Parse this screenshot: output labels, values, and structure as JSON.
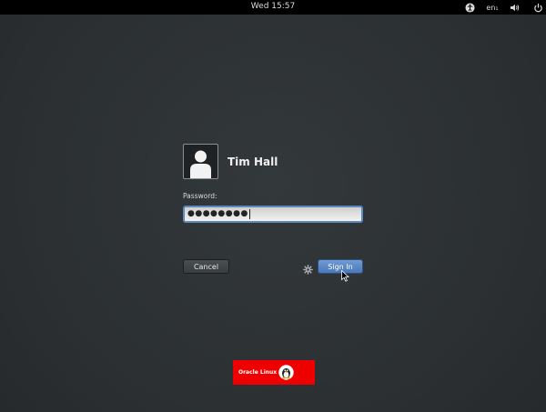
{
  "topbar": {
    "clock": "Wed 15:57",
    "language": "en₁",
    "icons": [
      "accessibility-icon",
      "volume-icon",
      "power-icon"
    ]
  },
  "login": {
    "username": "Tim Hall",
    "password_label": "Password:",
    "password_dots": "●●●●●●●●",
    "cancel_label": "Cancel",
    "signin_label": "Sign In",
    "session_icon": "gear-icon"
  },
  "branding": {
    "logo_text": "Oracle Linux"
  },
  "colors": {
    "background": "#2e3234",
    "accent": "#5d88bd",
    "logo_red": "#ee0000"
  }
}
